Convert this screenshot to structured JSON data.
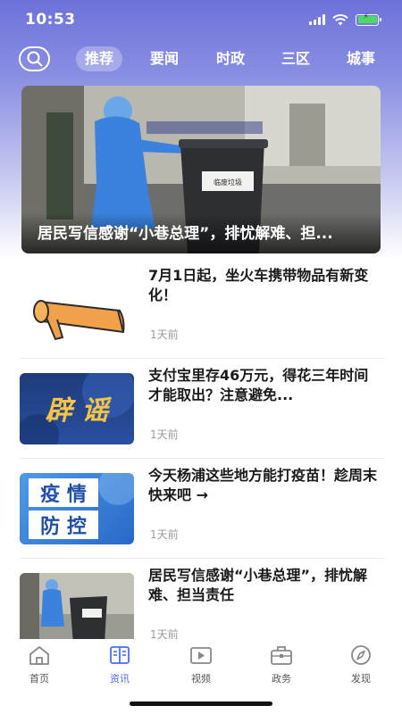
{
  "status_bar": {
    "time": "10:53"
  },
  "nav": {
    "tabs": [
      {
        "label": "推荐",
        "active": true
      },
      {
        "label": "要闻",
        "active": false
      },
      {
        "label": "时政",
        "active": false
      },
      {
        "label": "三区",
        "active": false
      },
      {
        "label": "城事",
        "active": false
      }
    ]
  },
  "hero": {
    "title": "居民写信感谢“小巷总理”，排忧解难、担...",
    "bin_label": "临废垃圾"
  },
  "news": [
    {
      "title": "7月1日起，坐火车携带物品有新变化！",
      "time": "1天前",
      "thumb": "megaphone"
    },
    {
      "title": "支付宝里存46万元，得花三年时间才能取出？注意避免...",
      "time": "1天前",
      "thumb": "rumor",
      "thumb_text": "辟 谣"
    },
    {
      "title": "今天杨浦这些地方能打疫苗！趁周末快来吧 →",
      "time": "1天前",
      "thumb": "epidemic",
      "thumb_text_1": "疫 情",
      "thumb_text_2": "防 控"
    },
    {
      "title": "居民写信感谢“小巷总理”，排忧解难、担当责任",
      "time": "1天前",
      "thumb": "photo"
    }
  ],
  "bottom_nav": [
    {
      "label": "首页",
      "icon": "home-icon",
      "active": false
    },
    {
      "label": "资讯",
      "icon": "news-icon",
      "active": true
    },
    {
      "label": "视频",
      "icon": "video-icon",
      "active": false
    },
    {
      "label": "政务",
      "icon": "briefcase-icon",
      "active": false
    },
    {
      "label": "发现",
      "icon": "compass-icon",
      "active": false
    }
  ],
  "colors": {
    "accent": "#4b6cff",
    "header_top": "#6d72d9"
  }
}
